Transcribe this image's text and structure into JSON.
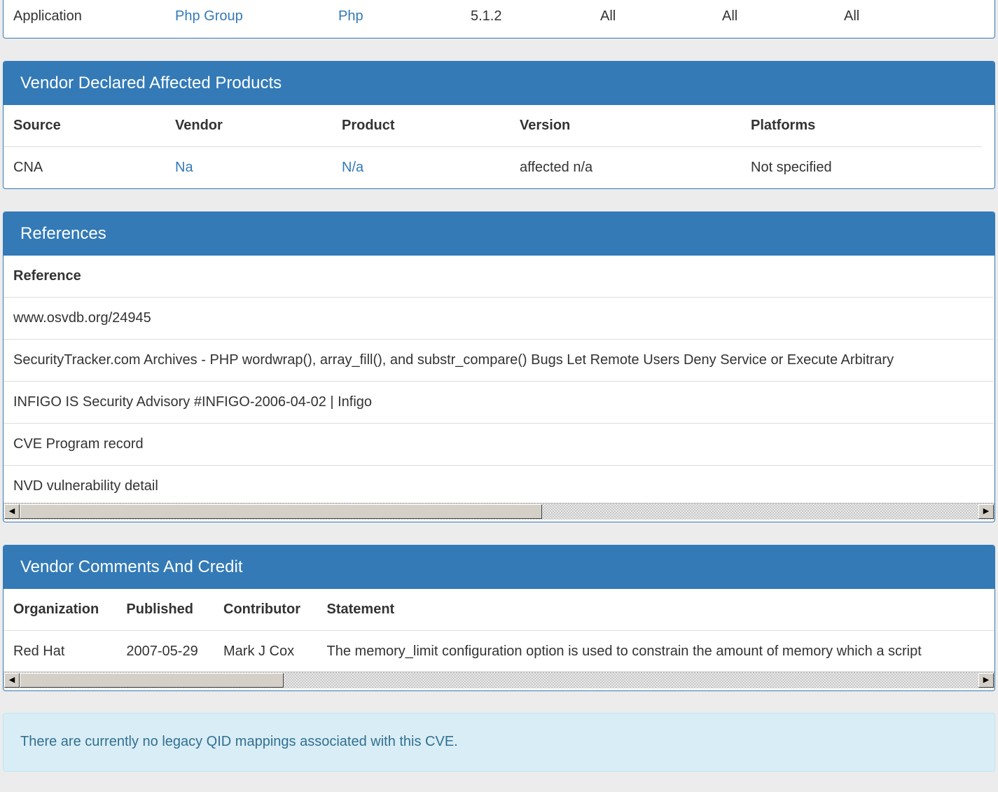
{
  "top_row": {
    "cells": [
      "Application",
      "Php Group",
      "Php",
      "5.1.2",
      "All",
      "All",
      "All"
    ]
  },
  "affected": {
    "title": "Vendor Declared Affected Products",
    "headers": [
      "Source",
      "Vendor",
      "Product",
      "Version",
      "Platforms"
    ],
    "rows": [
      [
        "CNA",
        "Na",
        "N/a",
        "affected n/a",
        "Not specified"
      ]
    ]
  },
  "references": {
    "title": "References",
    "header": "Reference",
    "items": [
      "www.osvdb.org/24945",
      "SecurityTracker.com Archives - PHP wordwrap(), array_fill(), and substr_compare() Bugs Let Remote Users Deny Service or Execute Arbitrary",
      "INFIGO IS Security Advisory #INFIGO-2006-04-02 | Infigo",
      "CVE Program record",
      "NVD vulnerability detail"
    ]
  },
  "comments": {
    "title": "Vendor Comments And Credit",
    "headers": [
      "Organization",
      "Published",
      "Contributor",
      "Statement"
    ],
    "rows": [
      [
        "Red Hat",
        "2007-05-29",
        "Mark J Cox",
        "The memory_limit configuration option is used to constrain the amount of memory which a script"
      ]
    ]
  },
  "notice": {
    "text": "There are currently no legacy QID mappings associated with this CVE."
  },
  "scrollbar": {
    "left_arrow": "◀",
    "right_arrow": "▶"
  }
}
